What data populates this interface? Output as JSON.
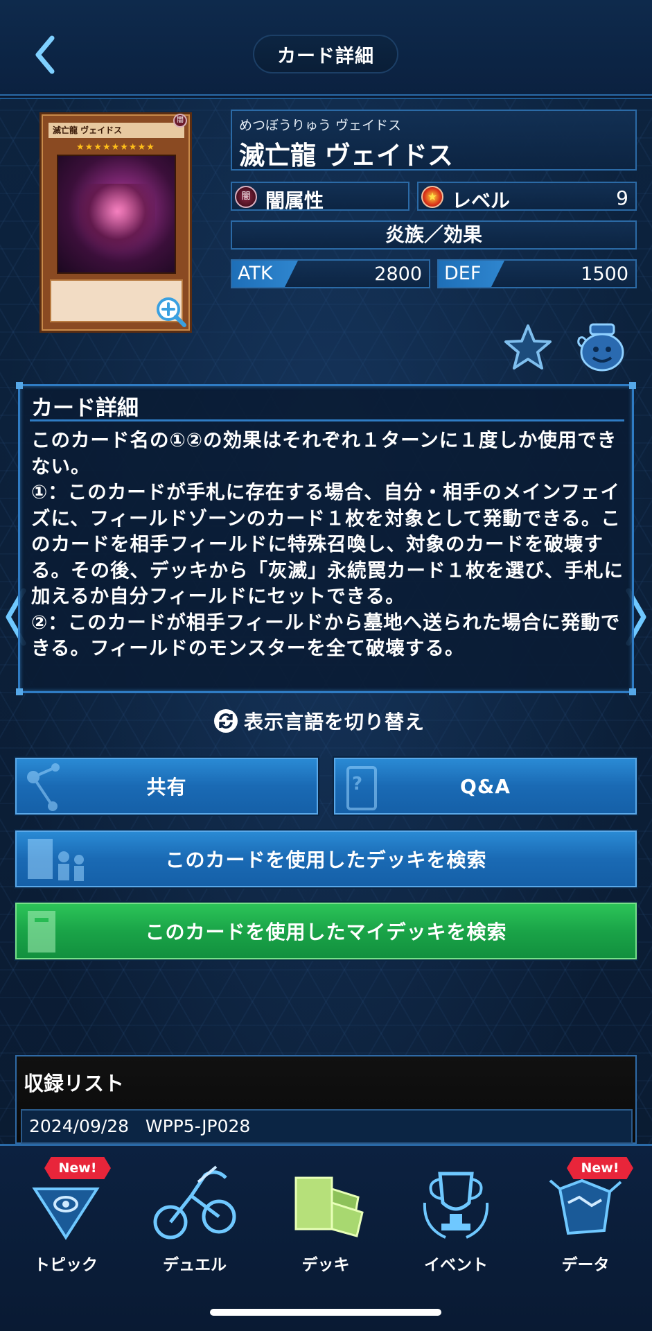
{
  "header": {
    "title": "カード詳細"
  },
  "card": {
    "image_name": "滅亡龍 ヴェイドス",
    "image_stars": "★★★★★★★★★",
    "furigana": "めつぼうりゅう ヴェイドス",
    "name": "滅亡龍 ヴェイドス",
    "attribute_icon": "闇",
    "attribute": "闇属性",
    "level_label": "レベル",
    "level": "9",
    "type": "炎族／効果",
    "atk_label": "ATK",
    "atk": "2800",
    "def_label": "DEF",
    "def": "1500"
  },
  "description": {
    "title": "カード詳細",
    "text": "このカード名の①②の効果はそれぞれ１ターンに１度しか使用できない。\n①：このカードが手札に存在する場合、自分・相手のメインフェイズに、フィールドゾーンのカード１枚を対象として発動できる。このカードを相手フィールドに特殊召喚し、対象のカードを破壊する。その後、デッキから「灰滅」永続罠カード１枚を選び、手札に加えるか自分フィールドにセットできる。\n②：このカードが相手フィールドから墓地へ送られた場合に発動できる。フィールドのモンスターを全て破壊する。"
  },
  "switch_language": "表示言語を切り替え",
  "buttons": {
    "share": "共有",
    "qa": "Q&A",
    "deck_search": "このカードを使用したデッキを検索",
    "mydeck_search": "このカードを使用したマイデッキを検索"
  },
  "recording_list": {
    "title": "収録リスト",
    "rows": [
      {
        "date": "2024/09/28",
        "code": "WPP5-JP028",
        "display": "2024/09/28   WPP5-JP028"
      }
    ]
  },
  "bottom_nav": {
    "items": [
      {
        "label": "トピック",
        "badge": "New!",
        "icon": "topic-icon"
      },
      {
        "label": "デュエル",
        "icon": "duel-icon"
      },
      {
        "label": "デッキ",
        "icon": "deck-icon"
      },
      {
        "label": "イベント",
        "icon": "event-icon"
      },
      {
        "label": "データ",
        "badge": "New!",
        "icon": "data-icon"
      }
    ]
  },
  "colors": {
    "accent_blue": "#1e6fb8",
    "accent_green": "#1aa448",
    "badge_red": "#e8253a"
  }
}
